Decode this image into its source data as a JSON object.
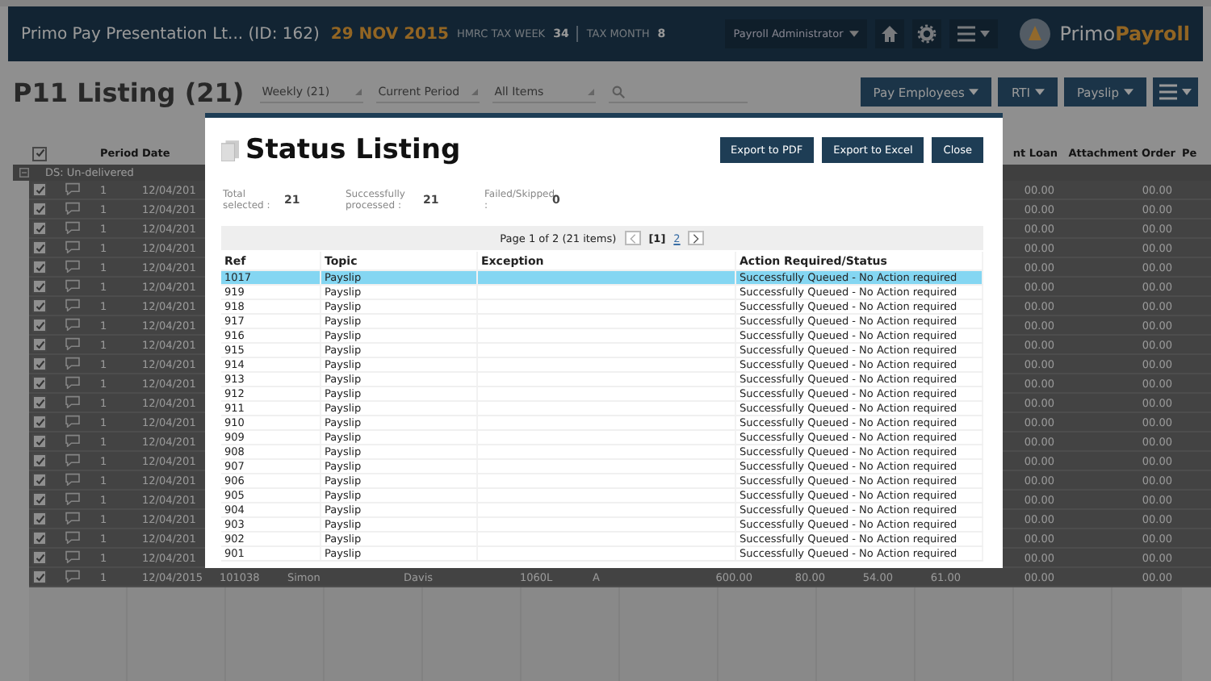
{
  "header": {
    "company": "Primo Pay Presentation Lt... (ID: 162)",
    "date": "29 NOV 2015",
    "tax_week_label": "HMRC TAX WEEK",
    "tax_week": "34",
    "tax_month_label": "TAX MONTH",
    "tax_month": "8",
    "role": "Payroll Administrator",
    "logo_primo": "Primo",
    "logo_payroll": "Payroll"
  },
  "toolbar": {
    "title": "P11 Listing (21)",
    "filters": [
      "Weekly (21)",
      "Current Period",
      "All Items"
    ],
    "buttons": [
      "Pay Employees",
      "RTI",
      "Payslip"
    ]
  },
  "listing": {
    "header_checked": true,
    "columns": {
      "period": "Period",
      "date": "Date",
      "loan": "nt Loan",
      "attachment": "Attachment Order",
      "pe": "Pe"
    },
    "group": "DS: Un-delivered",
    "rows": [
      {
        "checked": true,
        "period": "1",
        "date": "12/04/201",
        "cells": [],
        "loan": "00.00",
        "attachment": "00.00"
      },
      {
        "checked": true,
        "period": "1",
        "date": "12/04/201",
        "cells": [],
        "loan": "00.00",
        "attachment": "00.00"
      },
      {
        "checked": true,
        "period": "1",
        "date": "12/04/201",
        "cells": [],
        "loan": "00.00",
        "attachment": "00.00"
      },
      {
        "checked": true,
        "period": "1",
        "date": "12/04/201",
        "cells": [],
        "loan": "00.00",
        "attachment": "00.00"
      },
      {
        "checked": true,
        "period": "1",
        "date": "12/04/201",
        "cells": [],
        "loan": "00.00",
        "attachment": "00.00"
      },
      {
        "checked": true,
        "period": "1",
        "date": "12/04/201",
        "cells": [],
        "loan": "00.00",
        "attachment": "00.00"
      },
      {
        "checked": true,
        "period": "1",
        "date": "12/04/201",
        "cells": [],
        "loan": "00.00",
        "attachment": "00.00"
      },
      {
        "checked": true,
        "period": "1",
        "date": "12/04/201",
        "cells": [],
        "loan": "00.00",
        "attachment": "00.00"
      },
      {
        "checked": true,
        "period": "1",
        "date": "12/04/201",
        "cells": [],
        "loan": "00.00",
        "attachment": "00.00"
      },
      {
        "checked": true,
        "period": "1",
        "date": "12/04/201",
        "cells": [],
        "loan": "00.00",
        "attachment": "00.00"
      },
      {
        "checked": true,
        "period": "1",
        "date": "12/04/201",
        "cells": [],
        "loan": "00.00",
        "attachment": "00.00"
      },
      {
        "checked": true,
        "period": "1",
        "date": "12/04/201",
        "cells": [],
        "loan": "00.00",
        "attachment": "00.00"
      },
      {
        "checked": true,
        "period": "1",
        "date": "12/04/201",
        "cells": [],
        "loan": "00.00",
        "attachment": "00.00"
      },
      {
        "checked": true,
        "period": "1",
        "date": "12/04/201",
        "cells": [],
        "loan": "00.00",
        "attachment": "00.00"
      },
      {
        "checked": true,
        "period": "1",
        "date": "12/04/201",
        "cells": [],
        "loan": "00.00",
        "attachment": "00.00"
      },
      {
        "checked": true,
        "period": "1",
        "date": "12/04/201",
        "cells": [],
        "loan": "00.00",
        "attachment": "00.00"
      },
      {
        "checked": true,
        "period": "1",
        "date": "12/04/201",
        "cells": [],
        "loan": "00.00",
        "attachment": "00.00"
      },
      {
        "checked": true,
        "period": "1",
        "date": "12/04/201",
        "cells": [],
        "loan": "00.00",
        "attachment": "00.00"
      },
      {
        "checked": true,
        "period": "1",
        "date": "12/04/201",
        "cells": [],
        "loan": "00.00",
        "attachment": "00.00"
      },
      {
        "checked": true,
        "period": "1",
        "date": "12/04/201",
        "cells": [],
        "loan": "00.00",
        "attachment": "00.00"
      },
      {
        "checked": true,
        "period": "1",
        "date": "12/04/2015",
        "cells": [
          "101038",
          "Simon",
          "Davis",
          "1060L",
          "A",
          "600.00",
          "80.00",
          "54.00",
          "61.00"
        ],
        "loan": "00.00",
        "attachment": "00.00"
      }
    ]
  },
  "modal": {
    "title": "Status Listing",
    "buttons": [
      "Export to PDF",
      "Export to Excel",
      "Close"
    ],
    "summary": [
      {
        "label": "Total selected :",
        "value": "21"
      },
      {
        "label": "Successfully processed :",
        "value": "21"
      },
      {
        "label": "Failed/Skipped :",
        "value": "0"
      }
    ],
    "pager": {
      "info": "Page 1 of 2 (21 items)",
      "pages": [
        {
          "label": "[1]",
          "selected": true
        },
        {
          "label": "2",
          "selected": false
        }
      ]
    },
    "columns": [
      "Ref",
      "Topic",
      "Exception",
      "Action Required/Status"
    ],
    "rows": [
      {
        "ref": "1017",
        "topic": "Payslip",
        "exception": "",
        "status": "Successfully Queued - No Action required",
        "selected": true
      },
      {
        "ref": "919",
        "topic": "Payslip",
        "exception": "",
        "status": "Successfully Queued - No Action required",
        "selected": false
      },
      {
        "ref": "918",
        "topic": "Payslip",
        "exception": "",
        "status": "Successfully Queued - No Action required",
        "selected": false
      },
      {
        "ref": "917",
        "topic": "Payslip",
        "exception": "",
        "status": "Successfully Queued - No Action required",
        "selected": false
      },
      {
        "ref": "916",
        "topic": "Payslip",
        "exception": "",
        "status": "Successfully Queued - No Action required",
        "selected": false
      },
      {
        "ref": "915",
        "topic": "Payslip",
        "exception": "",
        "status": "Successfully Queued - No Action required",
        "selected": false
      },
      {
        "ref": "914",
        "topic": "Payslip",
        "exception": "",
        "status": "Successfully Queued - No Action required",
        "selected": false
      },
      {
        "ref": "913",
        "topic": "Payslip",
        "exception": "",
        "status": "Successfully Queued - No Action required",
        "selected": false
      },
      {
        "ref": "912",
        "topic": "Payslip",
        "exception": "",
        "status": "Successfully Queued - No Action required",
        "selected": false
      },
      {
        "ref": "911",
        "topic": "Payslip",
        "exception": "",
        "status": "Successfully Queued - No Action required",
        "selected": false
      },
      {
        "ref": "910",
        "topic": "Payslip",
        "exception": "",
        "status": "Successfully Queued - No Action required",
        "selected": false
      },
      {
        "ref": "909",
        "topic": "Payslip",
        "exception": "",
        "status": "Successfully Queued - No Action required",
        "selected": false
      },
      {
        "ref": "908",
        "topic": "Payslip",
        "exception": "",
        "status": "Successfully Queued - No Action required",
        "selected": false
      },
      {
        "ref": "907",
        "topic": "Payslip",
        "exception": "",
        "status": "Successfully Queued - No Action required",
        "selected": false
      },
      {
        "ref": "906",
        "topic": "Payslip",
        "exception": "",
        "status": "Successfully Queued - No Action required",
        "selected": false
      },
      {
        "ref": "905",
        "topic": "Payslip",
        "exception": "",
        "status": "Successfully Queued - No Action required",
        "selected": false
      },
      {
        "ref": "904",
        "topic": "Payslip",
        "exception": "",
        "status": "Successfully Queued - No Action required",
        "selected": false
      },
      {
        "ref": "903",
        "topic": "Payslip",
        "exception": "",
        "status": "Successfully Queued - No Action required",
        "selected": false
      },
      {
        "ref": "902",
        "topic": "Payslip",
        "exception": "",
        "status": "Successfully Queued - No Action required",
        "selected": false
      },
      {
        "ref": "901",
        "topic": "Payslip",
        "exception": "",
        "status": "Successfully Queued - No Action required",
        "selected": false
      }
    ]
  }
}
